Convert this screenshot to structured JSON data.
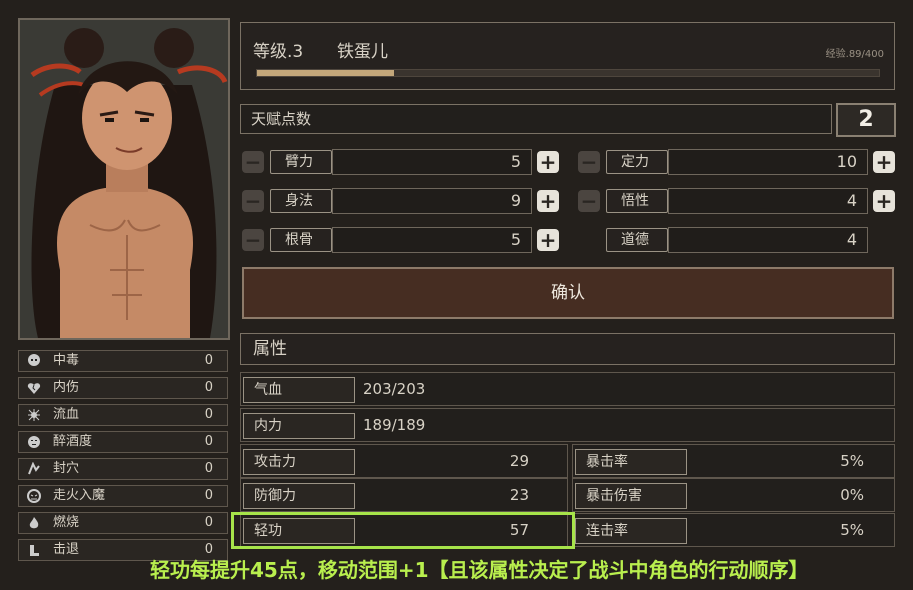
{
  "character": {
    "level_label": "等级.3",
    "name": "铁蛋儿",
    "exp_text": "经验.89/400",
    "exp_progress": 0.22
  },
  "status_effects": [
    {
      "icon": "skull-icon",
      "label": "中毒",
      "value": "0"
    },
    {
      "icon": "broken-heart-icon",
      "label": "内伤",
      "value": "0"
    },
    {
      "icon": "bleed-icon",
      "label": "流血",
      "value": "0"
    },
    {
      "icon": "drunk-face-icon",
      "label": "醉酒度",
      "value": "0"
    },
    {
      "icon": "seal-icon",
      "label": "封穴",
      "value": "0"
    },
    {
      "icon": "demon-icon",
      "label": "走火入魔",
      "value": "0"
    },
    {
      "icon": "fire-icon",
      "label": "燃烧",
      "value": "0"
    },
    {
      "icon": "knockback-icon",
      "label": "击退",
      "value": "0"
    }
  ],
  "talent": {
    "label": "天赋点数",
    "points": "2",
    "stats": [
      {
        "label": "臂力",
        "value": "5"
      },
      {
        "label": "定力",
        "value": "10"
      },
      {
        "label": "身法",
        "value": "9"
      },
      {
        "label": "悟性",
        "value": "4"
      },
      {
        "label": "根骨",
        "value": "5"
      },
      {
        "label": "道德",
        "value": "4"
      }
    ],
    "confirm_label": "确认"
  },
  "attributes": {
    "header": "属性",
    "hp": {
      "label": "气血",
      "value": "203/203"
    },
    "mp": {
      "label": "内力",
      "value": "189/189"
    },
    "left": [
      {
        "label": "攻击力",
        "value": "29"
      },
      {
        "label": "防御力",
        "value": "23"
      },
      {
        "label": "轻功",
        "value": "57"
      }
    ],
    "right": [
      {
        "label": "暴击率",
        "value": "5%"
      },
      {
        "label": "暴击伤害",
        "value": "0%"
      },
      {
        "label": "连击率",
        "value": "5%"
      }
    ]
  },
  "caption": "轻功每提升45点，移动范围+1【且该属性决定了战斗中角色的行动顺序】",
  "colors": {
    "highlight": "#a7e44a",
    "exp_bar": "#c3a77a",
    "confirm_bg": "#462d22"
  }
}
